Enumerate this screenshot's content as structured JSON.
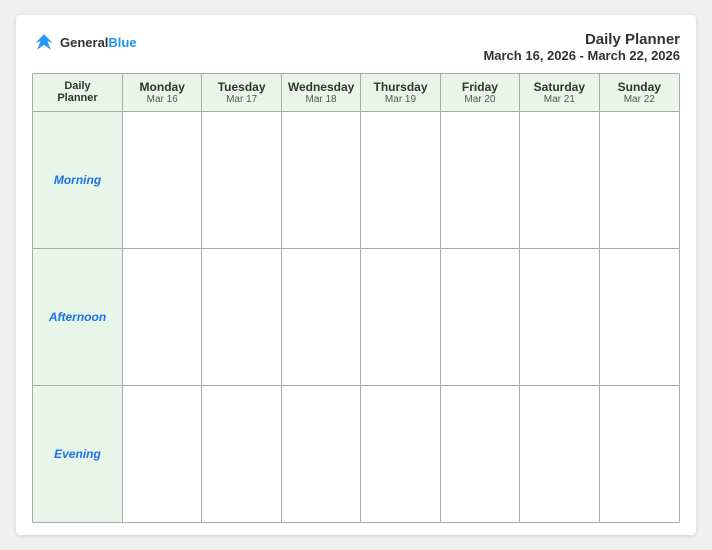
{
  "header": {
    "logo": {
      "general": "General",
      "blue": "Blue"
    },
    "title": "Daily Planner",
    "date_range": "March 16, 2026 - March 22, 2026"
  },
  "columns": [
    {
      "id": "label",
      "day_name": "Daily\nPlanner",
      "day_date": ""
    },
    {
      "id": "mon",
      "day_name": "Monday",
      "day_date": "Mar 16"
    },
    {
      "id": "tue",
      "day_name": "Tuesday",
      "day_date": "Mar 17"
    },
    {
      "id": "wed",
      "day_name": "Wednesday",
      "day_date": "Mar 18"
    },
    {
      "id": "thu",
      "day_name": "Thursday",
      "day_date": "Mar 19"
    },
    {
      "id": "fri",
      "day_name": "Friday",
      "day_date": "Mar 20"
    },
    {
      "id": "sat",
      "day_name": "Saturday",
      "day_date": "Mar 21"
    },
    {
      "id": "sun",
      "day_name": "Sunday",
      "day_date": "Mar 22"
    }
  ],
  "rows": [
    {
      "id": "morning",
      "label": "Morning"
    },
    {
      "id": "afternoon",
      "label": "Afternoon"
    },
    {
      "id": "evening",
      "label": "Evening"
    }
  ]
}
